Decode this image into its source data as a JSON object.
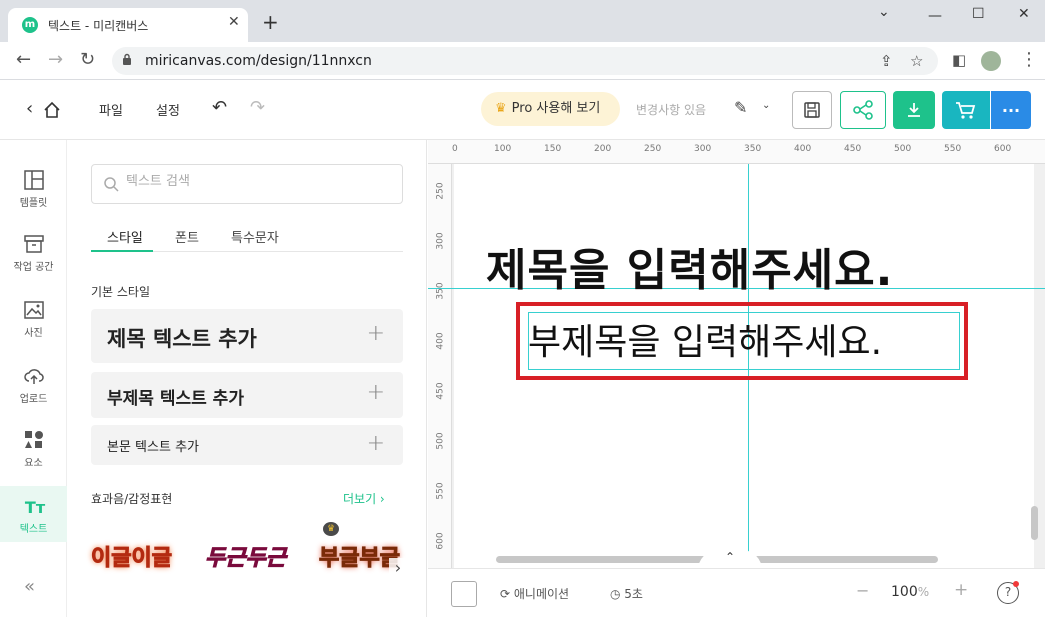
{
  "browser": {
    "tab_title": "텍스트 - 미리캔버스",
    "favicon_letter": "m",
    "new_tab": "+",
    "close_tab": "✕",
    "url": "miricanvas.com/design/11nnxcn"
  },
  "header": {
    "menu_file": "파일",
    "menu_settings": "설정",
    "pro_button": "Pro 사용해 보기",
    "changes_status": "변경사항 있음",
    "more_dots": "···",
    "colors": {
      "green": "#1ec28b",
      "teal": "#19b6c0",
      "blue": "#2a8be6"
    }
  },
  "rail": {
    "items": [
      {
        "label": "템플릿",
        "icon": "template-icon"
      },
      {
        "label": "작업 공간",
        "icon": "workspace-icon"
      },
      {
        "label": "사진",
        "icon": "photo-icon"
      },
      {
        "label": "업로드",
        "icon": "upload-icon"
      },
      {
        "label": "요소",
        "icon": "elements-icon"
      },
      {
        "label": "텍스트",
        "icon": "text-icon"
      }
    ],
    "collapse": "«"
  },
  "panel": {
    "search_placeholder": "텍스트 검색",
    "tabs": [
      "스타일",
      "폰트",
      "특수문자"
    ],
    "section_basic": "기본 스타일",
    "add_title": "제목 텍스트 추가",
    "add_subtitle": "부제목 텍스트 추가",
    "add_body": "본문 텍스트 추가",
    "plus": "+",
    "section_effects": "효과음/감정표현",
    "more": "더보기 ›",
    "stickers": [
      "이글이글",
      "두근두근",
      "부글부글"
    ],
    "next_arrow": "›"
  },
  "canvas": {
    "ruler_top": [
      "0",
      "100",
      "150",
      "200",
      "250",
      "300",
      "350",
      "400",
      "450",
      "500",
      "550",
      "600"
    ],
    "ruler_left": [
      "250",
      "300",
      "350",
      "400",
      "450",
      "500",
      "550",
      "600"
    ],
    "title_text": "제목을 입력해주세요.",
    "subtitle_text": "부제목을 입력해주세요.",
    "collapse_arrow": "⌃"
  },
  "bottom": {
    "animation": "애니메이션",
    "duration": "5초",
    "zoom_minus": "−",
    "zoom": "100",
    "zoom_unit": "%",
    "zoom_plus": "+",
    "help": "?"
  }
}
